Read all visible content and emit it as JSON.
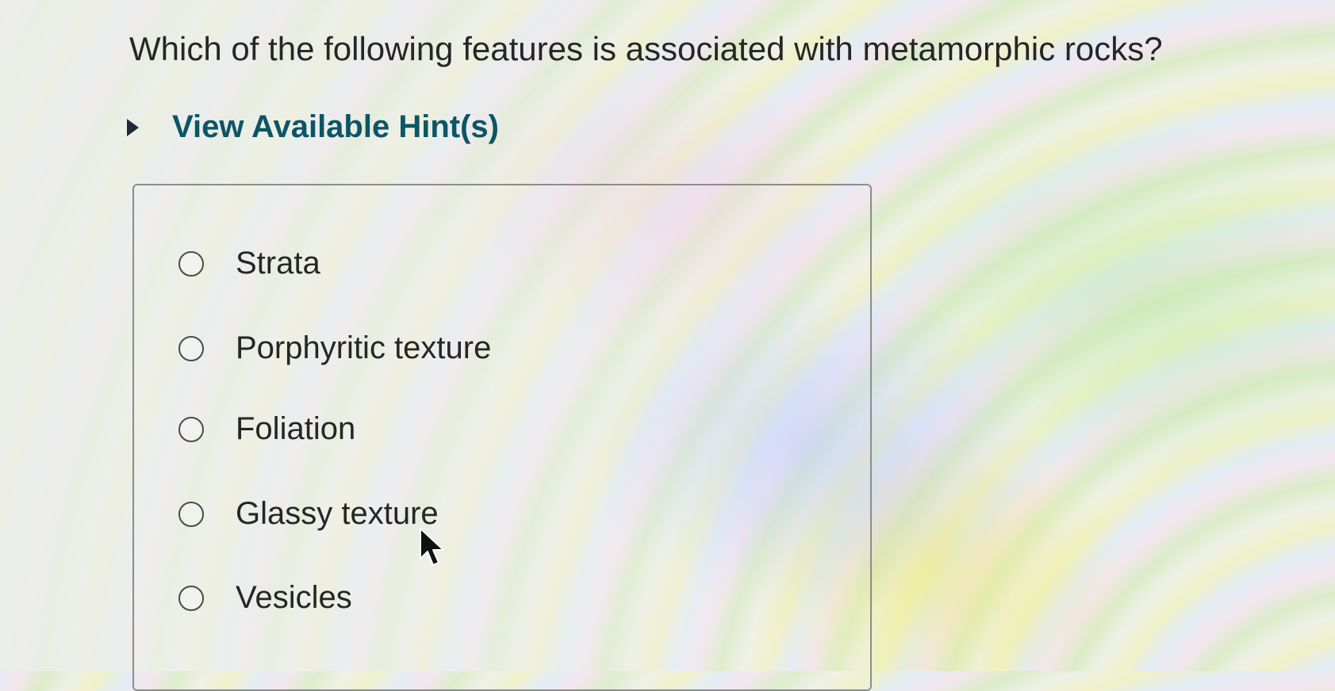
{
  "question": {
    "text": "Which of the following features is associated with metamorphic rocks?"
  },
  "hint": {
    "label": "View Available Hint(s)",
    "icon": "disclosure-triangle-right-icon"
  },
  "options": [
    {
      "label": "Strata",
      "selected": false
    },
    {
      "label": "Porphyritic texture",
      "selected": false
    },
    {
      "label": "Foliation",
      "selected": false
    },
    {
      "label": "Glassy texture",
      "selected": false
    },
    {
      "label": "Vesicles",
      "selected": false
    }
  ],
  "colors": {
    "hint_text": "#0b5566",
    "text": "#262626",
    "border": "#8c8c8c"
  }
}
